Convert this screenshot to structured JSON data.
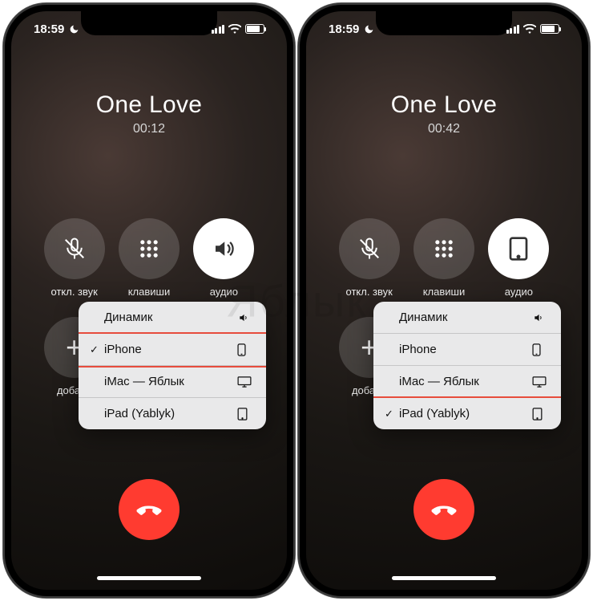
{
  "watermark": "Яблык",
  "status": {
    "time": "18:59"
  },
  "screens": [
    {
      "caller": "One Love",
      "timer": "00:12",
      "mute_label": "откл. звук",
      "keypad_label": "клавиши",
      "audio_label": "аудио",
      "add_label": "добави",
      "audio_active_icon": "speaker",
      "menu": [
        {
          "label": "Динамик",
          "glyph": "speaker",
          "checked": false,
          "highlight": false
        },
        {
          "label": "iPhone",
          "glyph": "phone",
          "checked": true,
          "highlight": true
        },
        {
          "label": "iMac — Яблык",
          "glyph": "desktop",
          "checked": false,
          "highlight": false
        },
        {
          "label": "iPad (Yablyk)",
          "glyph": "tablet",
          "checked": false,
          "highlight": false
        }
      ]
    },
    {
      "caller": "One Love",
      "timer": "00:42",
      "mute_label": "откл. звук",
      "keypad_label": "клавиши",
      "audio_label": "аудио",
      "add_label": "добави",
      "audio_active_icon": "tablet",
      "menu": [
        {
          "label": "Динамик",
          "glyph": "speaker",
          "checked": false,
          "highlight": false
        },
        {
          "label": "iPhone",
          "glyph": "phone",
          "checked": false,
          "highlight": false
        },
        {
          "label": "iMac — Яблык",
          "glyph": "desktop",
          "checked": false,
          "highlight": false
        },
        {
          "label": "iPad (Yablyk)",
          "glyph": "tablet",
          "checked": true,
          "highlight": true
        }
      ]
    }
  ]
}
